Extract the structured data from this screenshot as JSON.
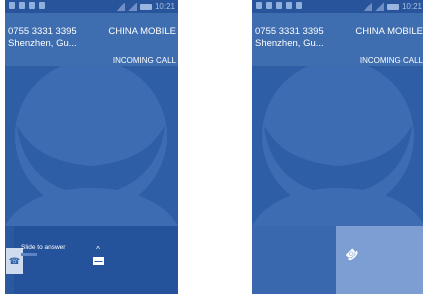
{
  "screens": [
    {
      "status_time": "10:21",
      "caller_number": "0755 3331 3395",
      "caller_location": "Shenzhen, Gu...",
      "carrier": "CHINA MOBILE",
      "call_state": "INCOMING CALL",
      "slide_label": "Slide to answer"
    },
    {
      "status_time": "10:21",
      "caller_number": "0755 3331 3395",
      "caller_location": "Shenzhen, Gu...",
      "carrier": "CHINA MOBILE",
      "call_state": "INCOMING CALL"
    }
  ],
  "icons": {
    "avatar": "person-silhouette-icon",
    "message": "message-envelope-icon",
    "answer": "answer-call-icon",
    "phone": "phone-handset-icon"
  },
  "colors": {
    "screen_bg": "#2d5ea6",
    "header_bg": "#3e6db0",
    "highlight": "#7c9ed2",
    "text": "#ffffff"
  }
}
